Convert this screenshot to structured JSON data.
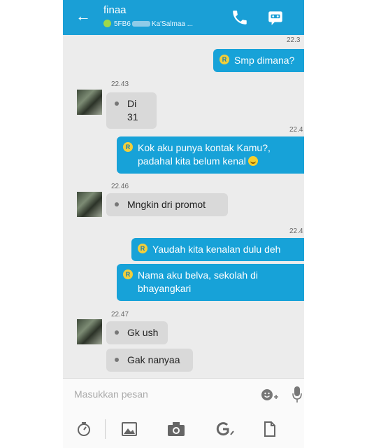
{
  "header": {
    "back_icon": "back-arrow-icon",
    "contact_name": "finaa",
    "status_prefix": "5FB6",
    "status_suffix": "Ka'Salmaa ...",
    "call_icon": "phone-icon",
    "profile_icon": "contact-card-icon"
  },
  "messages": {
    "m1": {
      "text": "Smp dimana?",
      "time": "22.3",
      "badge": "R"
    },
    "m2": {
      "text": "Di 31",
      "time": "22.43"
    },
    "m3": {
      "line1": "Kok aku punya kontak Kamu?,",
      "line2": "padahal kita belum kenal",
      "time": "22.4",
      "badge": "R"
    },
    "m4": {
      "text": "Mngkin dri promot",
      "time": "22.46"
    },
    "m5": {
      "text": "Yaudah kita kenalan dulu deh",
      "time": "22.4",
      "badge": "R"
    },
    "m6": {
      "line1": "Nama aku belva, sekolah di",
      "line2": "bhayangkari",
      "badge": "R"
    },
    "m7": {
      "text": "Gk ush",
      "time": "22.47"
    },
    "m8": {
      "text": "Gak nanyaa"
    }
  },
  "input": {
    "placeholder": "Masukkan pesan"
  },
  "toolbar": {
    "icons": [
      "timer-icon",
      "gallery-icon",
      "camera-icon",
      "google-icon",
      "file-icon"
    ]
  },
  "colors": {
    "header": "#1a9fd6",
    "outgoing": "#17a2d8",
    "incoming": "#d9d9d9",
    "background": "#ececec"
  }
}
